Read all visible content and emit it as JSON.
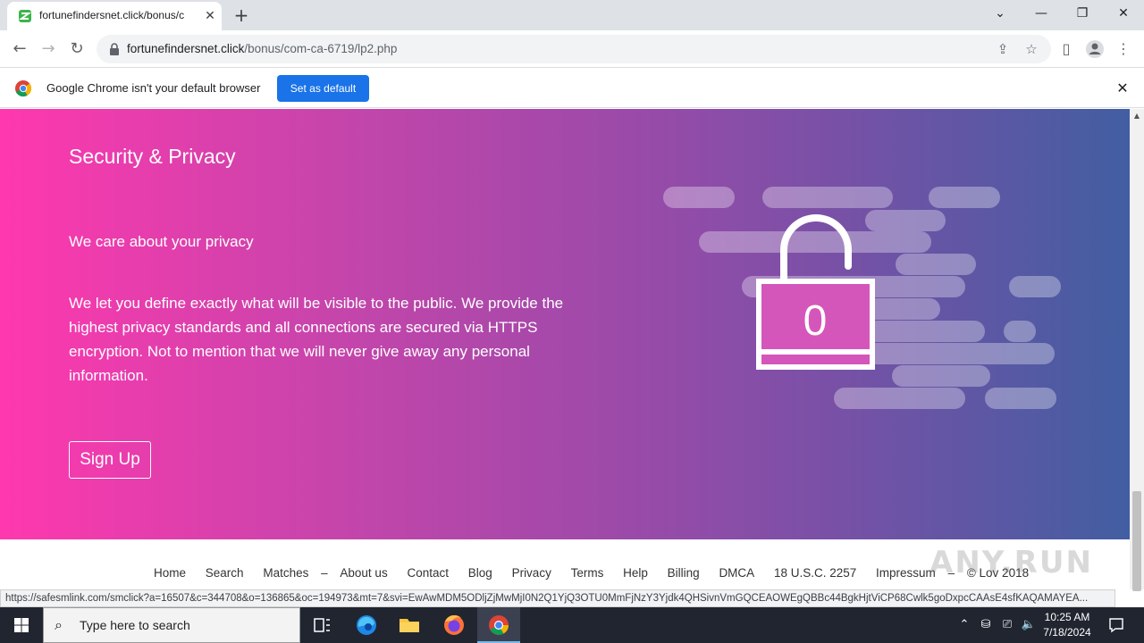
{
  "tab": {
    "title": "fortunefindersnet.click/bonus/c",
    "close": "✕"
  },
  "new_tab": "+",
  "window": {
    "tabsearch": "⌄",
    "minimize": "—",
    "restore": "❐",
    "close": "✕"
  },
  "toolbar": {
    "back": "←",
    "forward": "→",
    "reload": "↻",
    "url_domain": "fortunefindersnet.click",
    "url_path": "/bonus/com-ca-6719/lp2.php",
    "share": "⇪",
    "bookmark": "☆",
    "sidepanel": "▯",
    "profile": "●",
    "menu": "⋮"
  },
  "infobar": {
    "message": "Google Chrome isn't your default browser",
    "set_default_label": "Set as default",
    "close": "✕"
  },
  "hero": {
    "title": "Security & Privacy",
    "subtitle": "We care about your privacy",
    "body": "We let you define exactly what will be visible to the public. We provide the highest privacy standards and all connections are secured via HTTPS encryption. Not to mention that we will never give away any personal information.",
    "signup_label": "Sign Up",
    "lock_digit": "0"
  },
  "footer": {
    "links": [
      "Home",
      "Search",
      "Matches",
      "About us",
      "Contact",
      "Blog",
      "Privacy",
      "Terms",
      "Help",
      "Billing",
      "DMCA",
      "18 U.S.C. 2257",
      "Impressum"
    ],
    "separator": "–",
    "copyright": "© Lov 2018",
    "watermark": "ANY.RUN"
  },
  "scrollbar": {
    "up": "▲",
    "down": "▼"
  },
  "status_url": "https://safesmlink.com/smclick?a=16507&c=344708&o=136865&oc=194973&mt=7&svi=EwAwMDM5ODljZjMwMjI0N2Q1YjQ3OTU0MmFjNzY3Yjdk4QHSivnVmGQCEAOWEgQBBc44BgkHjtViCP68Cwlk5goDxpcCAAsE4sfKAQAMAYEA...",
  "taskbar": {
    "search_placeholder": "Type here to search",
    "time": "10:25 AM",
    "date": "7/18/2024"
  },
  "colors": {
    "hero_start": "#ff38ae",
    "hero_end": "#425ea2",
    "chrome_blue": "#1a73e8"
  }
}
